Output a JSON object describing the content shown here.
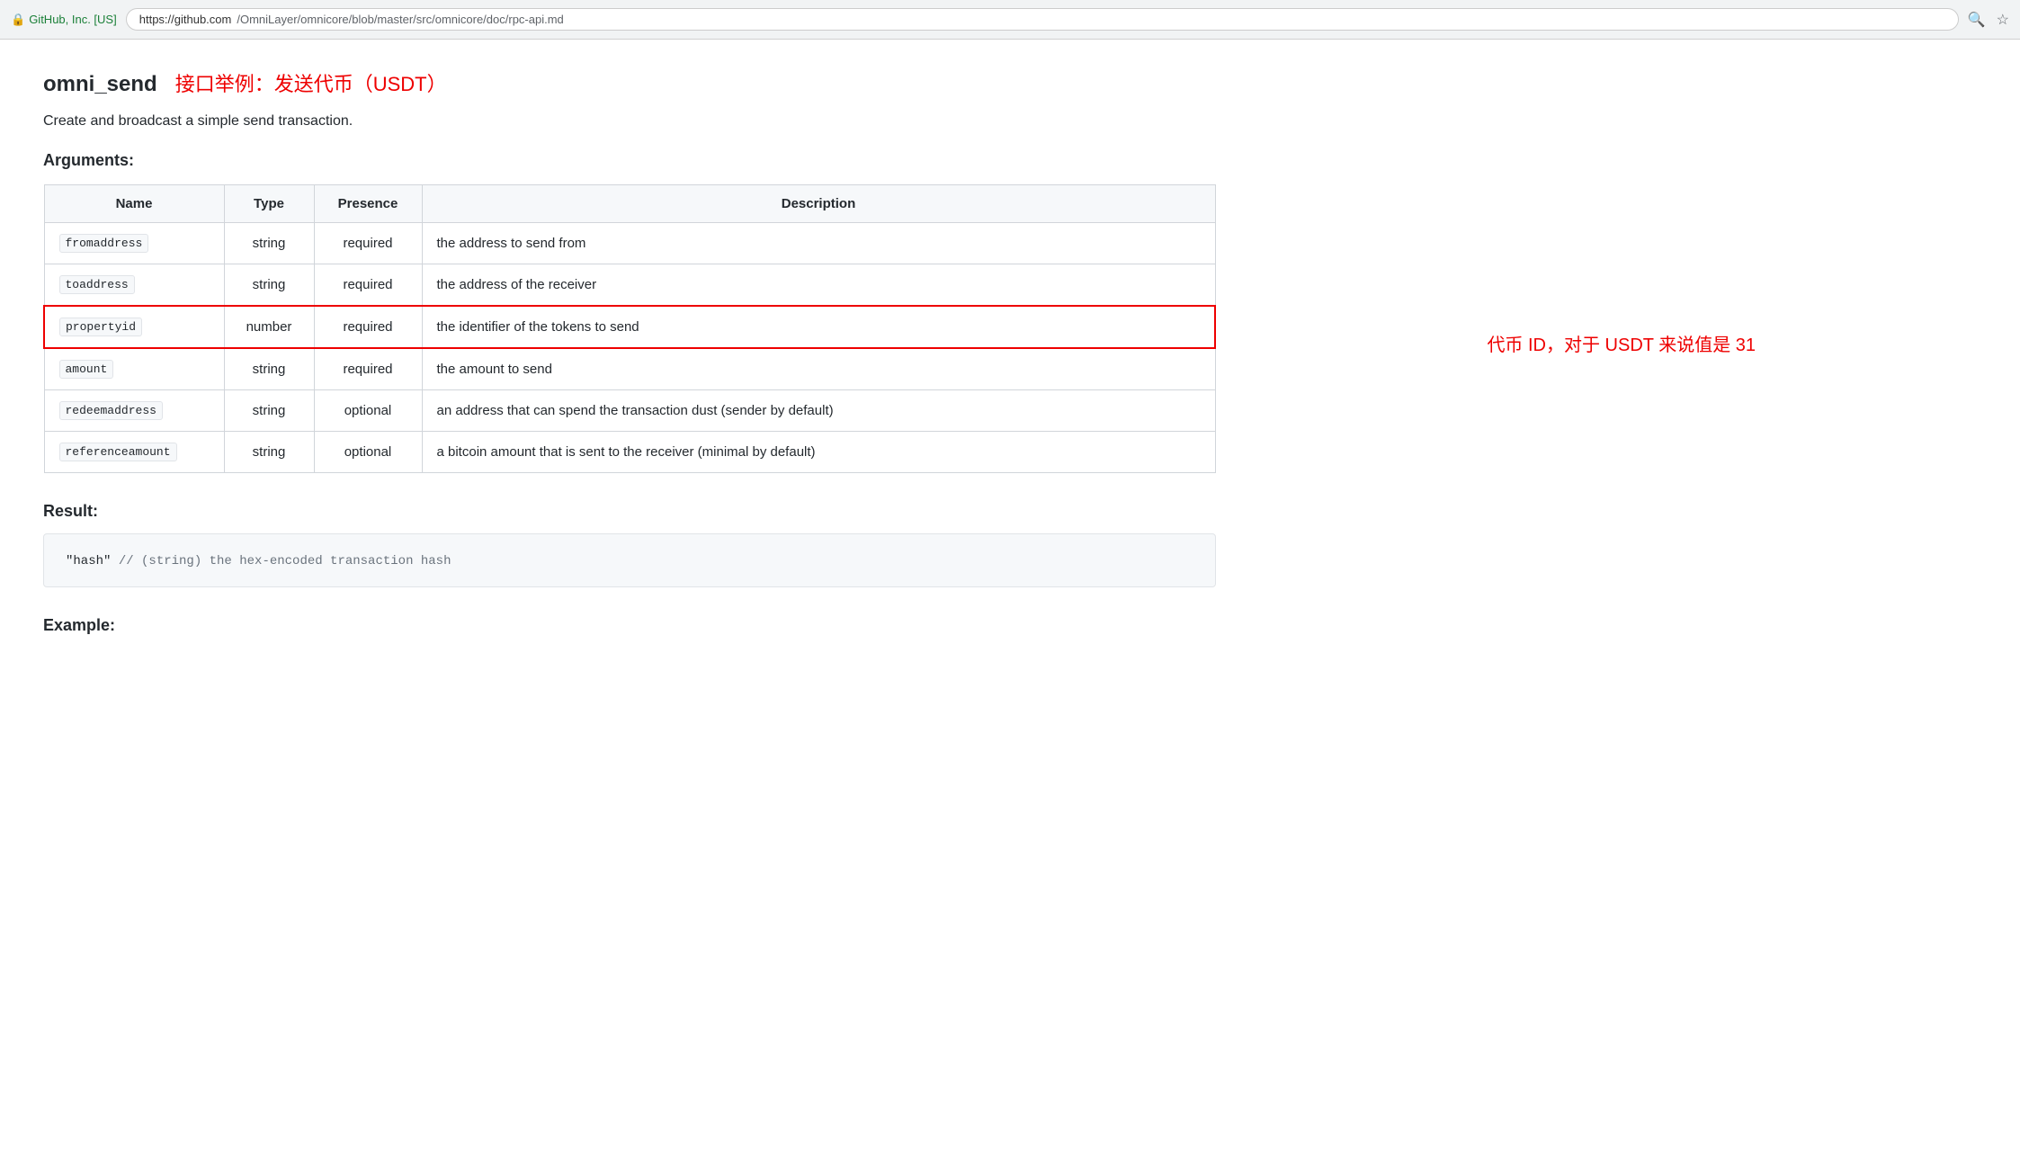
{
  "browser": {
    "lock_label": "GitHub, Inc. [US]",
    "url_domain": "https://github.com",
    "url_path": "/OmniLayer/omnicore/blob/master/src/omnicore/doc/rpc-api.md",
    "search_icon": "🔍",
    "star_icon": "☆"
  },
  "page": {
    "title": "omni_send",
    "title_chinese": "接口举例：发送代币（USDT）",
    "subtitle": "Create and broadcast a simple send transaction.",
    "arguments_heading": "Arguments:",
    "result_heading": "Result:",
    "example_heading": "Example:"
  },
  "table": {
    "headers": [
      "Name",
      "Type",
      "Presence",
      "Description"
    ],
    "rows": [
      {
        "name": "fromaddress",
        "type": "string",
        "presence": "required",
        "description": "the address to send from",
        "highlighted": false
      },
      {
        "name": "toaddress",
        "type": "string",
        "presence": "required",
        "description": "the address of the receiver",
        "highlighted": false
      },
      {
        "name": "propertyid",
        "type": "number",
        "presence": "required",
        "description": "the identifier of the tokens to send",
        "highlighted": true,
        "annotation": "代币 ID，对于 USDT 来说值是 31"
      },
      {
        "name": "amount",
        "type": "string",
        "presence": "required",
        "description": "the amount to send",
        "highlighted": false
      },
      {
        "name": "redeemaddress",
        "type": "string",
        "presence": "optional",
        "description": "an address that can spend the transaction dust (sender by default)",
        "highlighted": false
      },
      {
        "name": "referenceamount",
        "type": "string",
        "presence": "optional",
        "description": "a bitcoin amount that is sent to the receiver (minimal by default)",
        "highlighted": false
      }
    ]
  },
  "result": {
    "code": "\"hash\"  // (string) the hex-encoded transaction hash"
  }
}
